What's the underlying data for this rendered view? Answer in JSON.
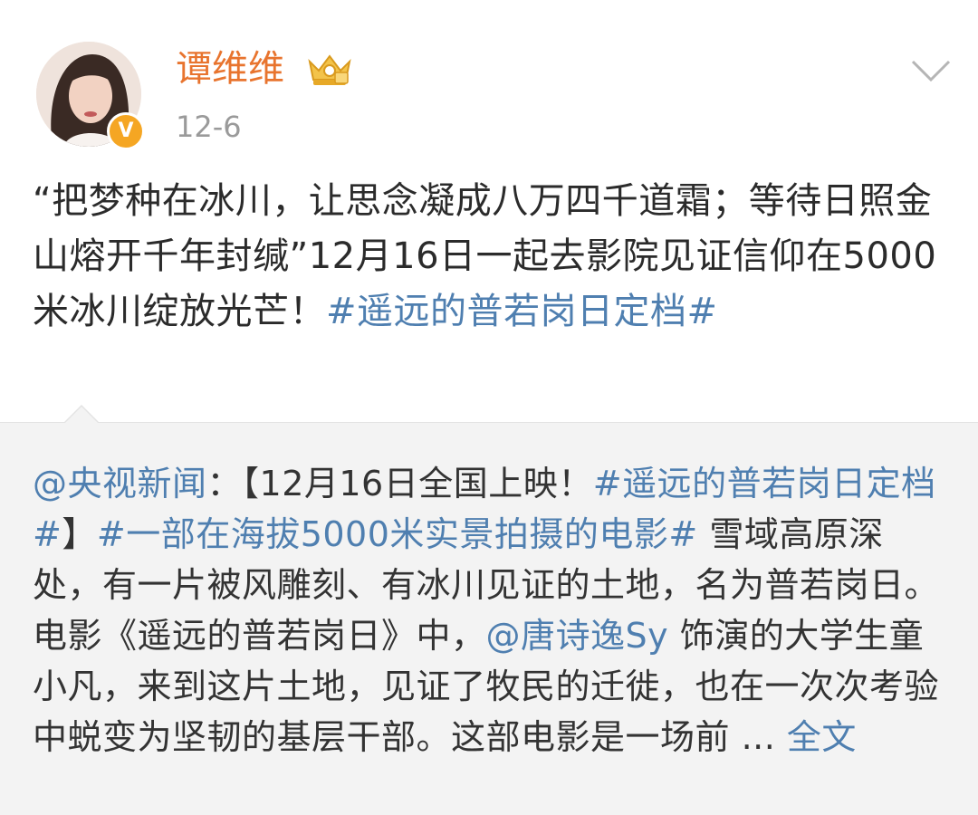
{
  "post": {
    "author": "谭维维",
    "date": "12-6",
    "verified_badge": "V",
    "icons": {
      "member_crown": "crown-icon",
      "expand": "chevron-down-icon"
    },
    "content": {
      "text_1": "“把梦种在冰川，让思念凝成八万四千道霜；等待日照金山熔开千年封缄”12月16日一起去影院见证信仰在5000米冰川绽放光芒！",
      "hashtag": "#遥远的普若岗日定档#"
    }
  },
  "repost": {
    "author_mention": "@央视新闻",
    "sep": "：【12月16日全国上映！",
    "hashtag_1": "#遥远的普若岗日定档#",
    "bracket_close": "】",
    "hashtag_2": "#一部在海拔5000米实景拍摄的电影#",
    "text_1": " 雪域高原深处，有一片被风雕刻、有冰川见证的土地，名为普若岗日。电影《遥远的普若岗日》中，",
    "mention_2": "@唐诗逸Sy",
    "text_2": " 饰演的大学生童小凡，来到这片土地，见证了牧民的迁徙，也在一次次考验中蜕变为坚韧的基层干部。这部电影是一场前 ",
    "ellipsis": "...",
    "more_link": " 全文"
  },
  "colors": {
    "author_name": "#e8742e",
    "link": "#4f7fb0",
    "date": "#9a9a9a",
    "repost_bg": "#f3f3f3",
    "badge": "#f5a623"
  }
}
